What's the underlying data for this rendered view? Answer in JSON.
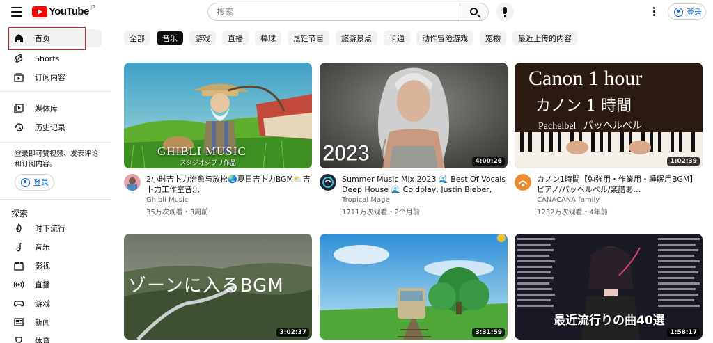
{
  "header": {
    "logo_text": "YouTube",
    "logo_region": "JP",
    "search_placeholder": "搜索",
    "signin_label": "登录"
  },
  "sidebar": {
    "items": [
      {
        "label": "首页",
        "icon": "home-icon"
      },
      {
        "label": "Shorts",
        "icon": "shorts-icon"
      },
      {
        "label": "订阅内容",
        "icon": "subscriptions-icon"
      },
      {
        "label": "媒体库",
        "icon": "library-icon"
      },
      {
        "label": "历史记录",
        "icon": "history-icon"
      }
    ],
    "signin_note": "登录即可赞视频、发表评论和订阅内容。",
    "signin_label": "登录",
    "explore_title": "探索",
    "explore_items": [
      {
        "label": "时下流行",
        "icon": "trending-icon"
      },
      {
        "label": "音乐",
        "icon": "music-icon"
      },
      {
        "label": "影视",
        "icon": "movies-icon"
      },
      {
        "label": "直播",
        "icon": "live-icon"
      },
      {
        "label": "游戏",
        "icon": "gaming-icon"
      },
      {
        "label": "新闻",
        "icon": "news-icon"
      },
      {
        "label": "体育",
        "icon": "sports-icon"
      }
    ]
  },
  "chips": [
    "全部",
    "音乐",
    "游戏",
    "直播",
    "棒球",
    "烹饪节目",
    "旅游景点",
    "卡通",
    "动作冒险游戏",
    "宠物",
    "最近上传的内容"
  ],
  "videos": [
    {
      "title": "2小时吉卜力治愈与放松🌏夏日吉卜力BGM⛅吉卜力工作室音乐",
      "channel": "Ghibli Music",
      "stats": "35万次观看・3周前",
      "duration": "",
      "thumb_text": "GHIBLI MUSIC",
      "thumb_sub": "スタジオジブリ作品"
    },
    {
      "title": "Summer Music Mix 2023 🌊 Best Of Vocals Deep House 🌊 Coldplay, Justin Bieber, Ala…",
      "channel": "Tropical Mage",
      "stats": "1711万次观看・2个月前",
      "duration": "4:00:26",
      "thumb_text": "2023"
    },
    {
      "title": "カノン1時間【勉強用・作業用・睡眠用BGM】ピアノ/パッヘルベル/楽譜あ…",
      "channel": "CANACANA family",
      "stats": "1232万次观看・4年前",
      "duration": "1:02:39",
      "thumb_text": "Canon 1 hour",
      "thumb_sub": "カノン 1 時間",
      "thumb_sub2": "Pachelbel   パッヘルベル"
    },
    {
      "title": "",
      "channel": "",
      "stats": "",
      "duration": "3:02:37",
      "thumb_text": "ゾーンに入るBGM"
    },
    {
      "title": "",
      "channel": "",
      "stats": "",
      "duration": "3:31:59",
      "thumb_text": ""
    },
    {
      "title": "",
      "channel": "",
      "stats": "",
      "duration": "1:58:17",
      "thumb_text": "最近流行りの曲40選"
    }
  ],
  "colors": {
    "brand": "#ff0000",
    "link": "#065fd4",
    "chip_active": "#0f0f0f"
  }
}
